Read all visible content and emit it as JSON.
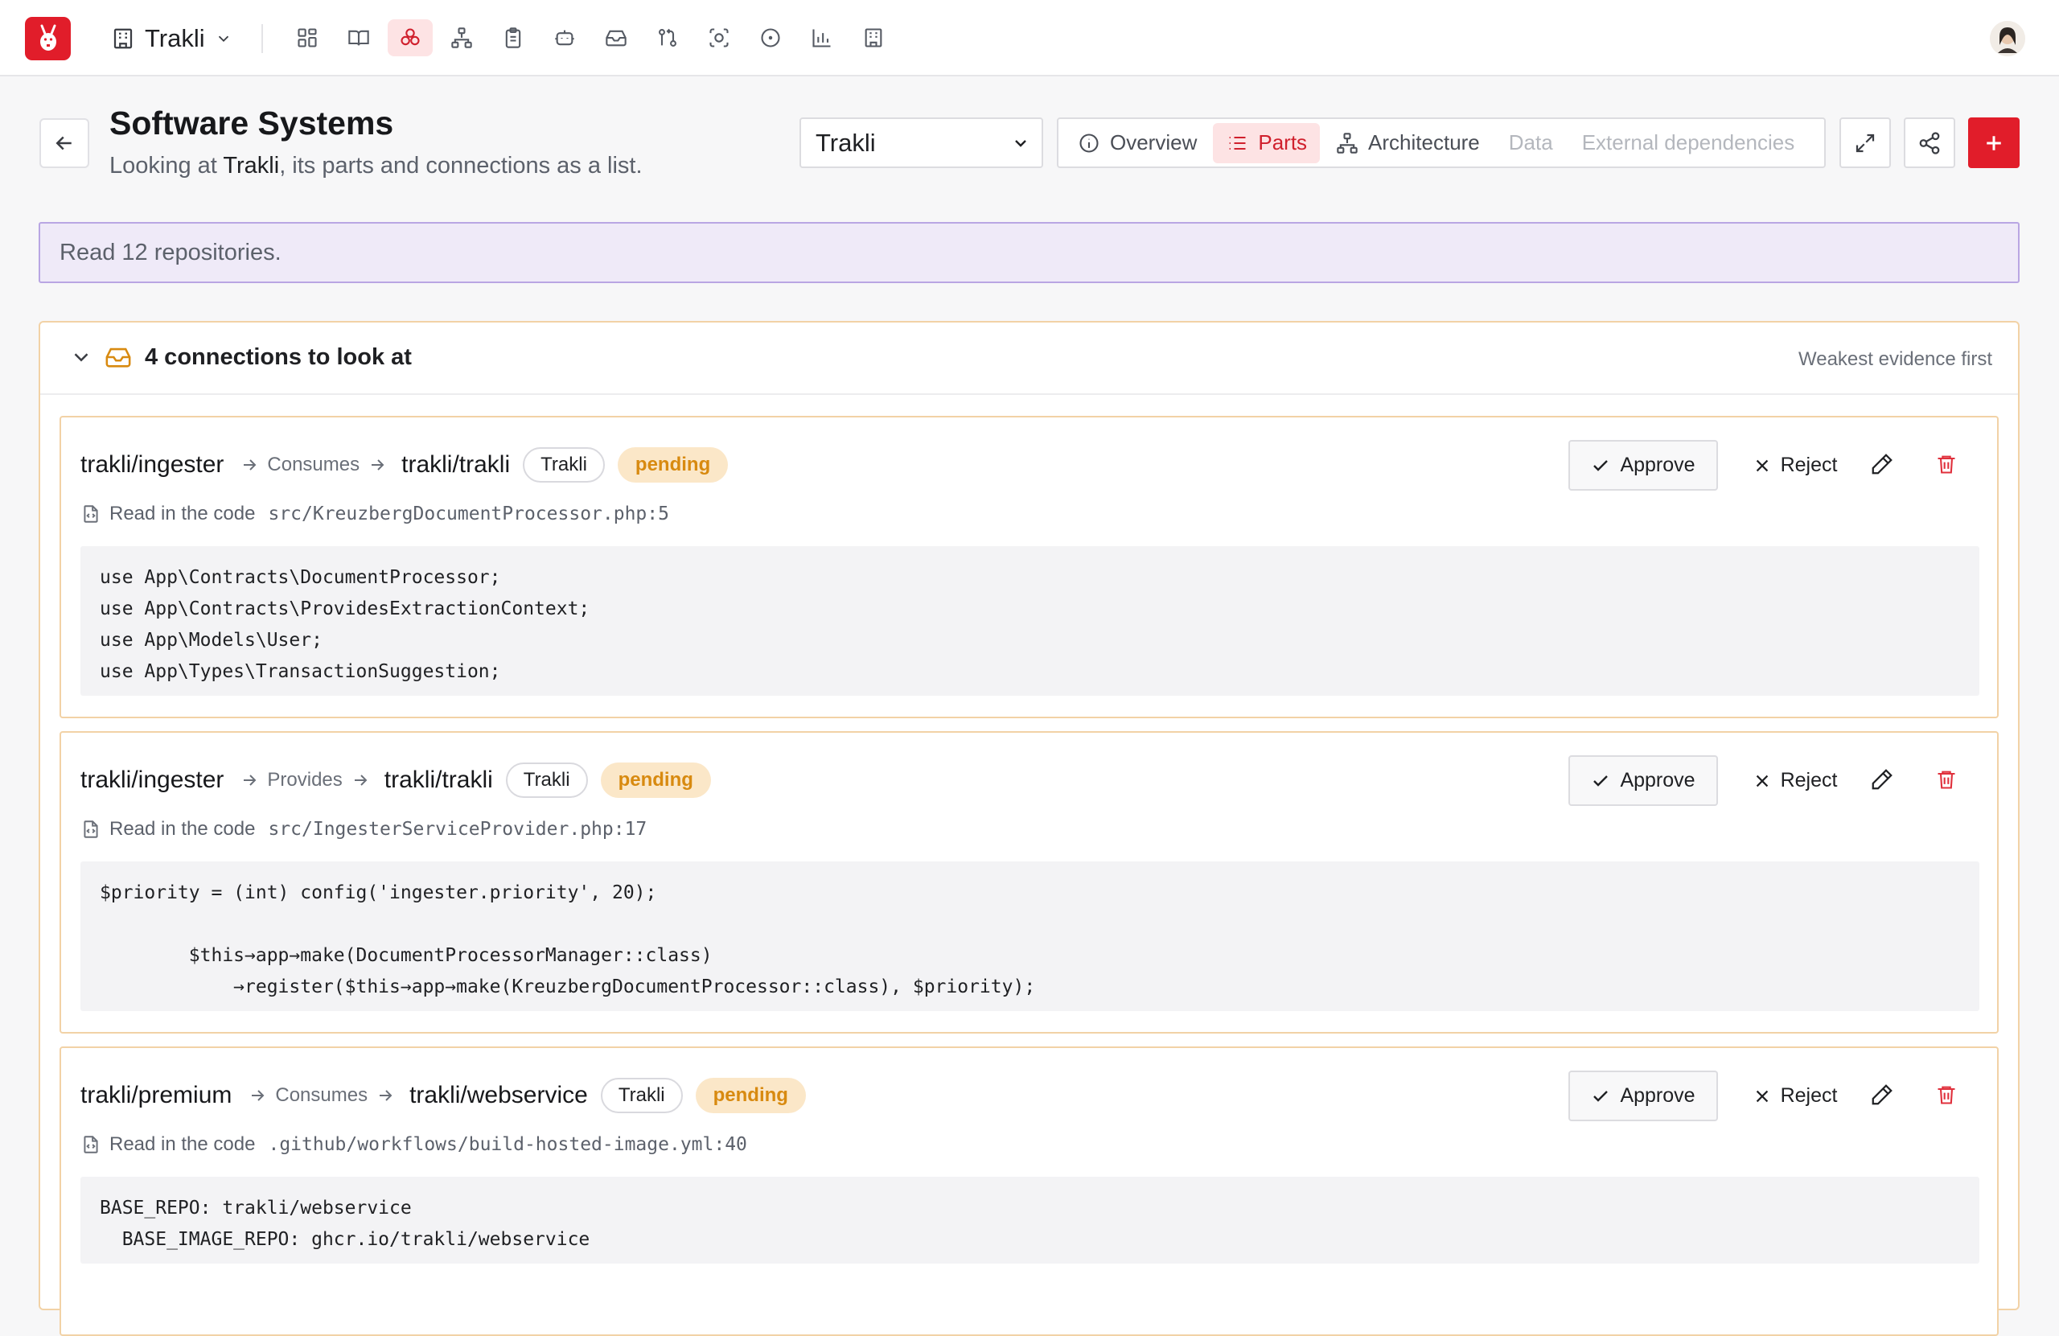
{
  "app": {
    "workspace": "Trakli",
    "nav_icons": [
      "dashboard-icon",
      "book-icon",
      "parts-icon",
      "architecture-icon",
      "clipboard-icon",
      "bot-icon",
      "inbox-icon",
      "git-compare-icon",
      "scan-icon",
      "circle-icon",
      "bar-chart-icon",
      "building-icon"
    ],
    "active_nav_index": 2
  },
  "header": {
    "title": "Software Systems",
    "subtitle_prefix": "Looking at ",
    "subtitle_system": "Trakli",
    "subtitle_suffix": ", its parts and connections as a list.",
    "system_select": "Trakli",
    "tabs": [
      {
        "label": "Overview",
        "icon": "info-icon",
        "state": "normal"
      },
      {
        "label": "Parts",
        "icon": "list-icon",
        "state": "active"
      },
      {
        "label": "Architecture",
        "icon": "architecture-icon",
        "state": "normal"
      },
      {
        "label": "Data",
        "icon": "",
        "state": "disabled"
      },
      {
        "label": "External dependencies",
        "icon": "",
        "state": "disabled"
      }
    ]
  },
  "notice": "Read 12 repositories.",
  "review": {
    "title": "4 connections to look at",
    "sort_label": "Weakest evidence first",
    "approve_label": "Approve",
    "reject_label": "Reject",
    "source_label": "Read in the code",
    "connections": [
      {
        "from": "trakli/ingester",
        "relation": "Consumes",
        "to": "trakli/trakli",
        "system": "Trakli",
        "status": "pending",
        "path": "src/KreuzbergDocumentProcessor.php:5",
        "code": "use App\\Contracts\\DocumentProcessor;\nuse App\\Contracts\\ProvidesExtractionContext;\nuse App\\Models\\User;\nuse App\\Types\\TransactionSuggestion;"
      },
      {
        "from": "trakli/ingester",
        "relation": "Provides",
        "to": "trakli/trakli",
        "system": "Trakli",
        "status": "pending",
        "path": "src/IngesterServiceProvider.php:17",
        "code": "$priority = (int) config('ingester.priority', 20);\n\n        $this→app→make(DocumentProcessorManager::class)\n            →register($this→app→make(KreuzbergDocumentProcessor::class), $priority);"
      },
      {
        "from": "trakli/premium",
        "relation": "Consumes",
        "to": "trakli/webservice",
        "system": "Trakli",
        "status": "pending",
        "path": ".github/workflows/build-hosted-image.yml:40",
        "code": "BASE_REPO: trakli/webservice\n  BASE_IMAGE_REPO: ghcr.io/trakli/webservice"
      }
    ]
  },
  "colors": {
    "brand": "#e11d2a",
    "active_bg": "#fde3e4",
    "pending_text": "#d88a10",
    "pending_bg": "#fbe7c8",
    "notice_bg": "#efeaf8",
    "notice_border": "#b9a6e3",
    "card_border": "#f2d2a6"
  }
}
